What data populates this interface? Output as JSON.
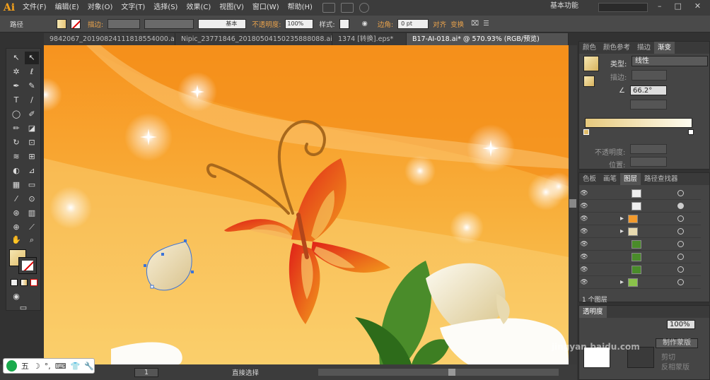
{
  "app": {
    "logo": "Ai",
    "workspace": "基本功能"
  },
  "menu": [
    "文件(F)",
    "编辑(E)",
    "对象(O)",
    "文字(T)",
    "选择(S)",
    "效果(C)",
    "视图(V)",
    "窗口(W)",
    "帮助(H)"
  ],
  "control": {
    "object_type": "路径",
    "stroke_label": "描边:",
    "brush_label": "基本",
    "opacity_label": "不透明度:",
    "opacity_value": "100%",
    "style_label": "样式:",
    "corner_label": "边角:",
    "corner_value": "0 pt",
    "align_label": "对齐",
    "transform_label": "变换"
  },
  "tabs": [
    "9842067_20190824111818554000.ai*",
    "Nipic_23771846_20180504150235888088.ai*",
    "1374 [转换].eps*",
    "B17-AI-018.ai* @ 570.93% (RGB/预览)"
  ],
  "gradient_panel": {
    "tabs": [
      "颜色",
      "颜色参考",
      "描边",
      "渐变"
    ],
    "type_label": "类型:",
    "type_value": "线性",
    "stroke_label": "描边:",
    "angle_value": "66.2°",
    "opacity_label": "不透明度:",
    "position_label": "位置:"
  },
  "layers_panel": {
    "tabs": [
      "色板",
      "画笔",
      "图层",
      "路径查找器"
    ],
    "status": "1 个图层"
  },
  "transparency_panel": {
    "tabs": [
      "透明度"
    ],
    "opacity_value": "100%",
    "make_mask": "制作蒙版",
    "clip": "剪切",
    "invert": "反相蒙版"
  },
  "status": {
    "tool": "直接选择",
    "page": "1"
  },
  "ime": {
    "label": "五"
  },
  "watermark": "jingyan.baidu.com",
  "colors": {
    "canvas_orange": "#f7931e",
    "butterfly_red": "#e8401b",
    "leaf_green": "#4a8c2a",
    "accent": "#e8a24c"
  }
}
